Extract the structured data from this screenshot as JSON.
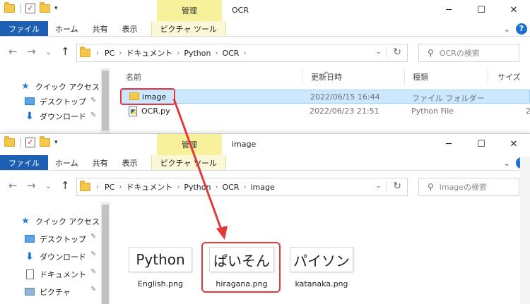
{
  "win1": {
    "title": "OCR",
    "manage_tab": "管理",
    "ribbon": {
      "file": "ファイル",
      "home": "ホーム",
      "share": "共有",
      "view": "表示",
      "picture_tools": "ピクチャ ツール"
    },
    "breadcrumb": [
      "PC",
      "ドキュメント",
      "Python",
      "OCR"
    ],
    "search_placeholder": "OCRの検索",
    "nav": {
      "quick_access": "クイック アクセス",
      "desktop": "デスクトップ",
      "downloads": "ダウンロード"
    },
    "columns": {
      "name": "名前",
      "date": "更新日時",
      "type": "種類",
      "size": "サイズ"
    },
    "files": [
      {
        "name": "image",
        "date": "2022/06/15 16:44",
        "type": "ファイル フォルダー",
        "size": ""
      },
      {
        "name": "OCR.py",
        "date": "2022/06/23 21:51",
        "type": "Python File",
        "size": "2"
      }
    ]
  },
  "win2": {
    "title": "image",
    "manage_tab": "管理",
    "ribbon": {
      "file": "ファイル",
      "home": "ホーム",
      "share": "共有",
      "view": "表示",
      "picture_tools": "ピクチャ ツール"
    },
    "breadcrumb": [
      "PC",
      "ドキュメント",
      "Python",
      "OCR",
      "image"
    ],
    "search_placeholder": "imageの検索",
    "nav": {
      "quick_access": "クイック アクセス",
      "desktop": "デスクトップ",
      "downloads": "ダウンロード",
      "documents": "ドキュメント",
      "pictures": "ピクチャ"
    },
    "thumbnails": [
      {
        "image_text": "Python",
        "caption": "English.png"
      },
      {
        "image_text": "ぱいそん",
        "caption": "hiragana.png"
      },
      {
        "image_text": "パイソン",
        "caption": "katanaka.png"
      }
    ]
  },
  "icons": {
    "minimize": "─",
    "maximize": "☐",
    "close": "✕",
    "help": "?",
    "back": "←",
    "forward": "→",
    "recent": "⌄",
    "up": "↑",
    "sep": "›",
    "refresh": "↻",
    "search": "⚲",
    "pin": "📌",
    "star": "★",
    "download": "⬇"
  },
  "colors": {
    "file_tab": "#1c5fb3",
    "manage_tab": "#f6f19a",
    "selection": "#cce8ff",
    "highlight": "#e23a3a"
  }
}
